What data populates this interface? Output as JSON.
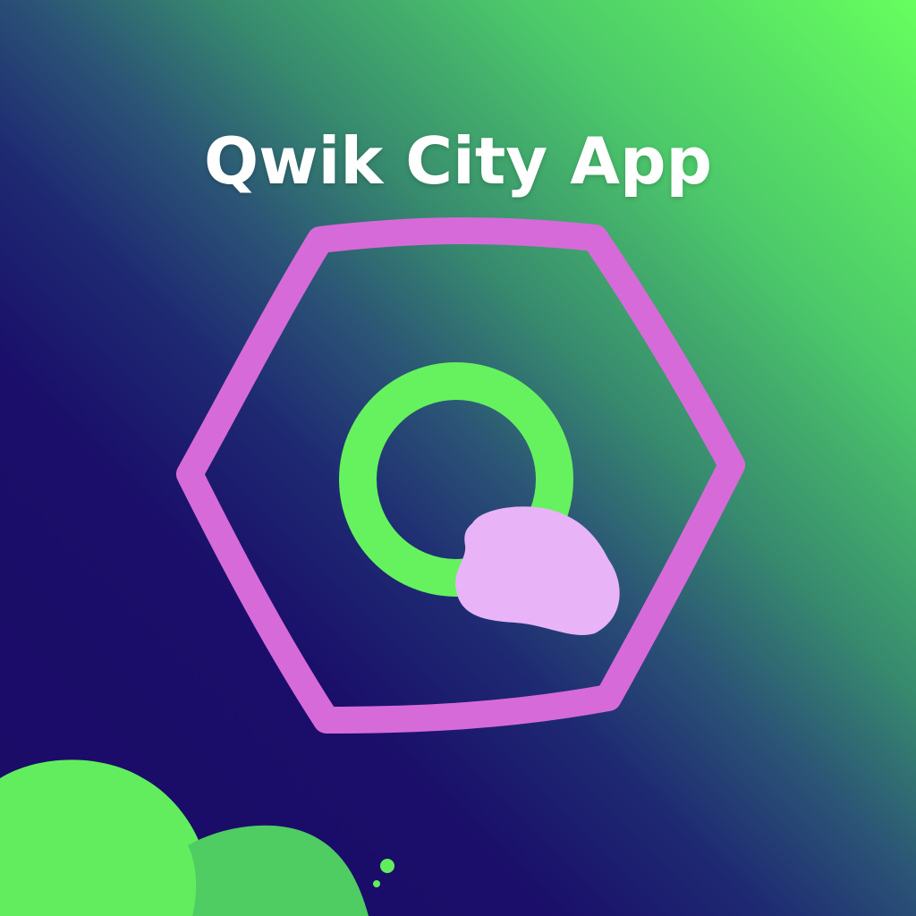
{
  "app": {
    "title": "Qwik City App"
  },
  "logo": {
    "icon": "qwik-hexagon-logo-icon",
    "colors": {
      "hexagon_stroke": "#d76ad9",
      "ring": "#66f25e",
      "blob": "#e8b3f7"
    }
  },
  "background": {
    "gradient": [
      "#66ff5e",
      "#378a6e",
      "#1a0b66"
    ],
    "corner_blob_color": "#62ed5e"
  }
}
